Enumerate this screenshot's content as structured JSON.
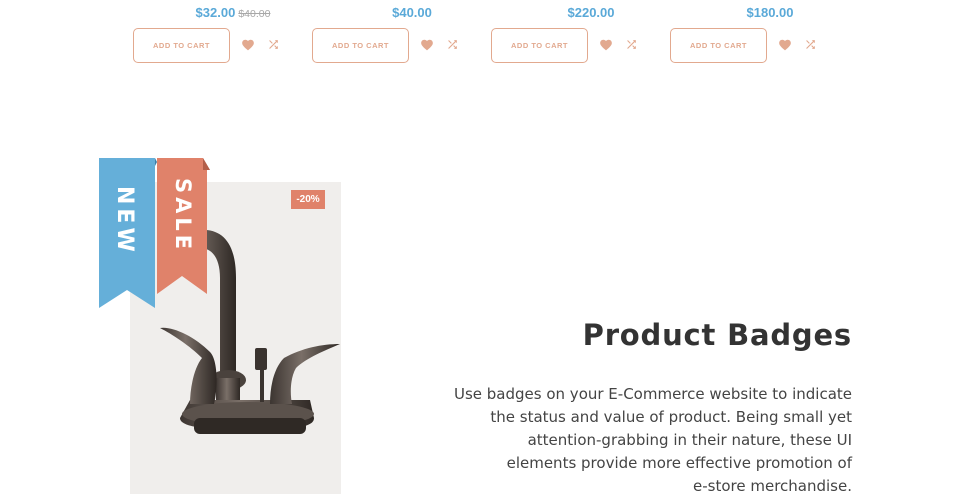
{
  "products": [
    {
      "price": "$32.00",
      "old_price": "$40.00",
      "add_to_cart": "ADD TO CART"
    },
    {
      "price": "$40.00",
      "old_price": "",
      "add_to_cart": "ADD TO CART"
    },
    {
      "price": "$220.00",
      "old_price": "",
      "add_to_cart": "ADD TO CART"
    },
    {
      "price": "$180.00",
      "old_price": "",
      "add_to_cart": "ADD TO CART"
    }
  ],
  "badges": {
    "new_label": "NEW",
    "sale_label": "SALE",
    "discount_label": "-20%"
  },
  "section": {
    "title": "Product Badges",
    "description_lines": [
      "Use badges on your E-Commerce website to indicate",
      "the status and value of product. Being small yet",
      "attention-grabbing in their nature, these UI",
      "elements provide more effective promotion of",
      "e-store merchandise."
    ]
  },
  "colors": {
    "price_blue": "#5aa9d8",
    "accent_salmon": "#e2a98f",
    "ribbon_blue": "#65afd9",
    "ribbon_orange": "#e0826a"
  },
  "icons": {
    "wishlist": "heart-icon",
    "compare": "shuffle-icon"
  }
}
